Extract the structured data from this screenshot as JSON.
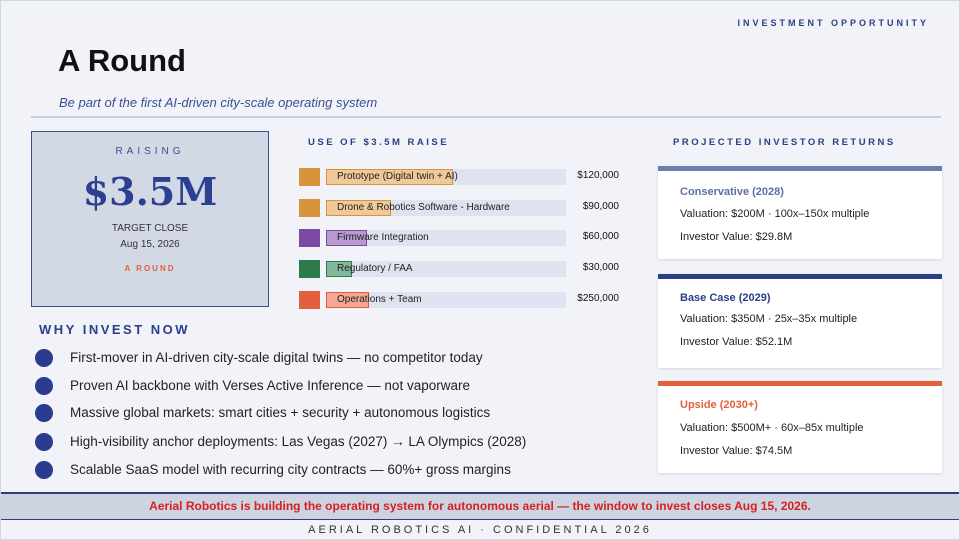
{
  "header": {
    "kicker": "INVESTMENT OPPORTUNITY",
    "title": "A Round",
    "subtitle": "Be part of the first AI-driven city-scale operating system"
  },
  "raising": {
    "label": "RAISING",
    "amount": "$3.5M",
    "target_label": "TARGET CLOSE",
    "target_date": "Aug 15, 2026",
    "round": "A ROUND"
  },
  "use_of_funds": {
    "title": "USE OF $3.5M RAISE",
    "items": [
      {
        "label": "Prototype (Digital twin + AI)",
        "value": "$120,000",
        "share": 0.53,
        "color": "#d8943a",
        "fill": "#f0c99a"
      },
      {
        "label": "Drone & Robotics Software - Hardware",
        "value": "$90,000",
        "share": 0.27,
        "color": "#d8943a",
        "fill": "#f0c99a"
      },
      {
        "label": "Firmware Integration",
        "value": "$60,000",
        "share": 0.17,
        "color": "#7b4aa0",
        "fill": "#b99ad0"
      },
      {
        "label": "Regulatory / FAA",
        "value": "$30,000",
        "share": 0.11,
        "color": "#2d7a4d",
        "fill": "#83b99a"
      },
      {
        "label": "Operations + Team",
        "value": "$250,000",
        "share": 0.18,
        "color": "#e35f3c",
        "fill": "#f2a892"
      }
    ]
  },
  "why_invest": {
    "title": "WHY INVEST NOW",
    "items": [
      "First-mover in AI-driven city-scale digital twins — no competitor today",
      "Proven AI backbone with Verses Active Inference — not vaporware",
      "Massive global markets: smart cities + security + autonomous logistics",
      "High-visibility anchor deployments: Las Vegas (2027) → LA Olympics (2028)",
      "Scalable SaaS model with recurring city contracts — 60%+ gross margins"
    ]
  },
  "returns": {
    "title": "PROJECTED INVESTOR RETURNS",
    "cards": [
      {
        "head": "Conservative  (2028)",
        "valuation": "Valuation: $200M  ·  100x–150x multiple",
        "investor_value": "Investor Value: $29.8M",
        "color": "#6b7fb0",
        "head_color": "#5b6ea3"
      },
      {
        "head": "Base Case  (2029)",
        "valuation": "Valuation: $350M  ·  25x–35x multiple",
        "investor_value": "Investor Value: $52.1M",
        "color": "#2a3f86",
        "head_color": "#2a3f86"
      },
      {
        "head": "Upside  (2030+)",
        "valuation": "Valuation: $500M+  ·  60x–85x multiple",
        "investor_value": "Investor Value: $74.5M",
        "color": "#e35f3c",
        "head_color": "#e35f3c"
      }
    ]
  },
  "footer": {
    "cta": "Aerial Robotics is building the operating system for autonomous aerial — the window to invest closes Aug 15, 2026.",
    "confidential": "AERIAL ROBOTICS AI  ·  CONFIDENTIAL 2026"
  }
}
